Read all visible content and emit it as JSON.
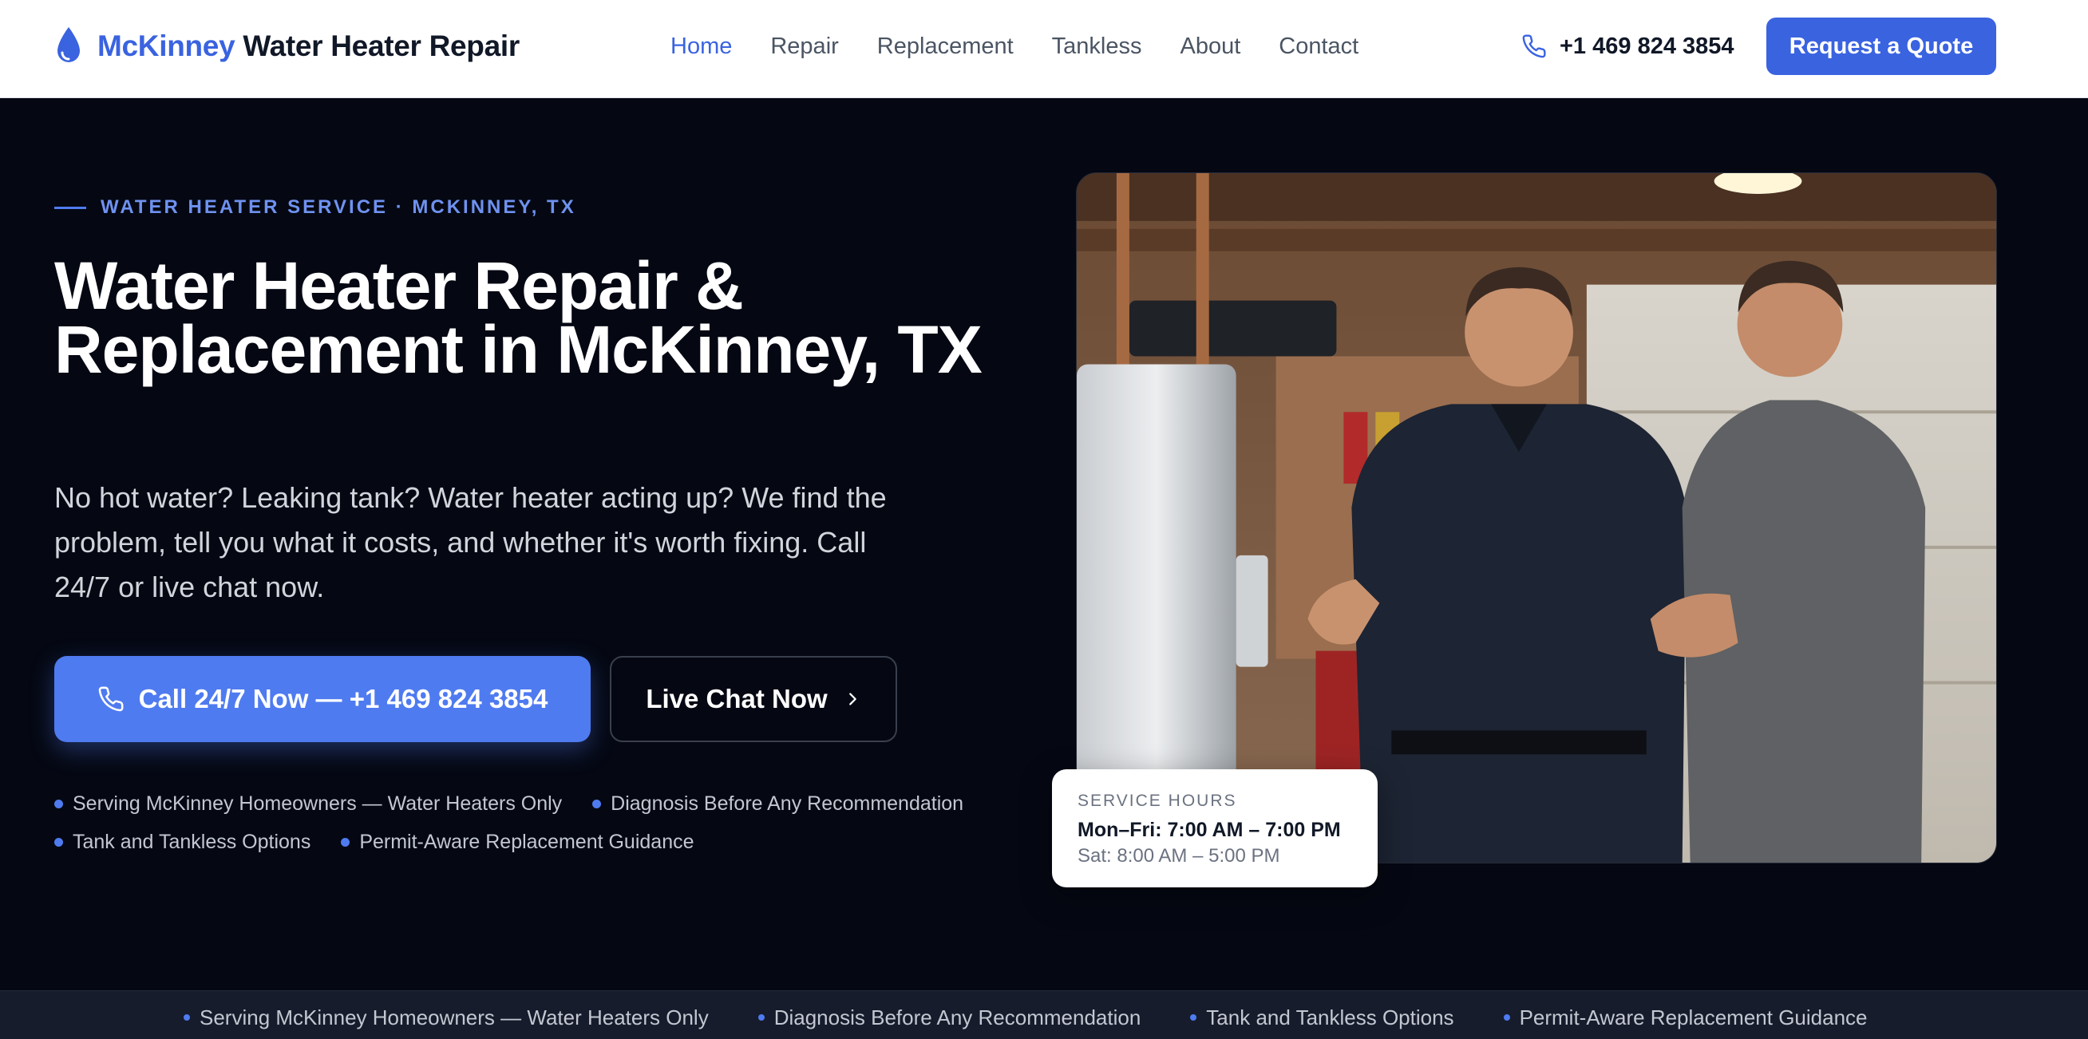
{
  "header": {
    "brand_accent": "McKinney",
    "brand_rest": "Water Heater Repair",
    "nav": [
      "Home",
      "Repair",
      "Replacement",
      "Tankless",
      "About",
      "Contact"
    ],
    "active_nav": "Home",
    "phone": "+1 469 824 3854",
    "quote_label": "Request a Quote"
  },
  "hero": {
    "eyebrow": "WATER HEATER SERVICE · MCKINNEY, TX",
    "title": "Water Heater Repair & Replacement in McKinney, TX",
    "subtitle": "No hot water? Leaking tank? Water heater acting up? We find the problem, tell you what it costs, and whether it's worth fixing. Call 24/7 or live chat now.",
    "call_label": "Call 24/7 Now — +1 469 824 3854",
    "chat_label": "Live Chat Now",
    "bullets": [
      "Serving McKinney Homeowners — Water Heaters Only",
      "Diagnosis Before Any Recommendation",
      "Tank and Tankless Options",
      "Permit-Aware Replacement Guidance"
    ]
  },
  "hours": {
    "label": "SERVICE HOURS",
    "weekday": "Mon–Fri: 7:00 AM – 7:00 PM",
    "saturday": "Sat: 8:00 AM – 5:00 PM"
  },
  "strip": {
    "items": [
      "Serving McKinney Homeowners — Water Heaters Only",
      "Diagnosis Before Any Recommendation",
      "Tank and Tankless Options",
      "Permit-Aware Replacement Guidance"
    ]
  },
  "colors": {
    "accent": "#3a63e0",
    "accent_light": "#4f7bf0",
    "hero_bg": "#050813",
    "strip_bg": "#161c2b"
  },
  "icons": {
    "logo": "water-drop-icon",
    "phone": "phone-icon",
    "chat_arrow": "chevron-right-icon"
  }
}
